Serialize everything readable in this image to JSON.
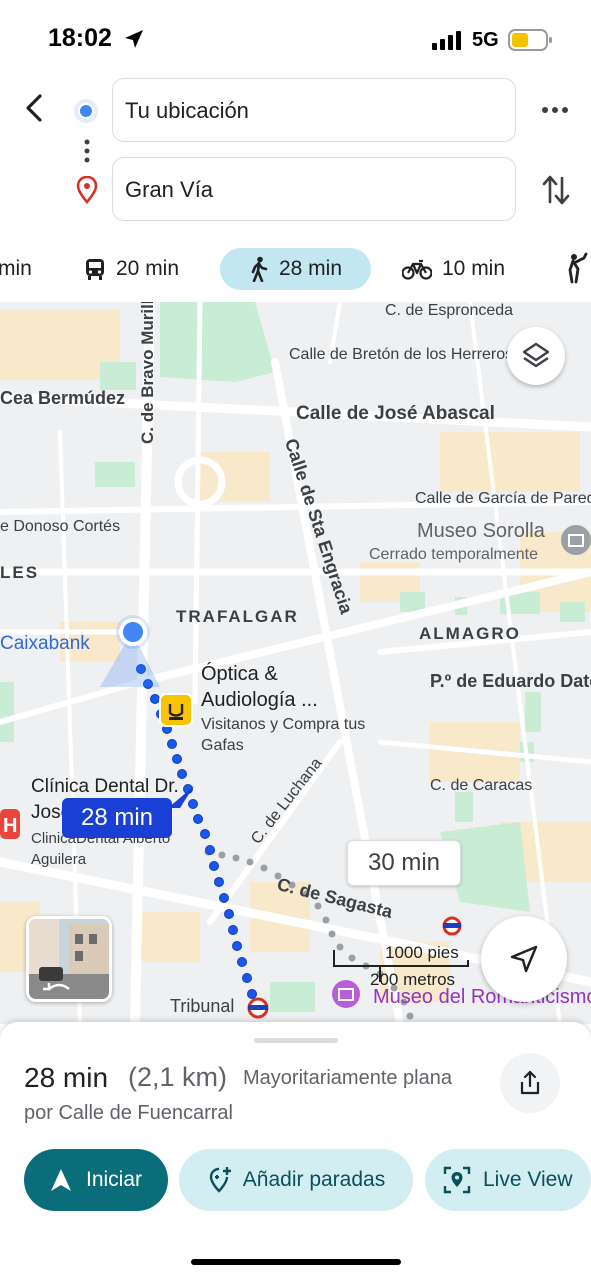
{
  "status_bar": {
    "time": "18:02",
    "network": "5G"
  },
  "directions": {
    "origin": "Tu ubicación",
    "destination": "Gran Vía"
  },
  "modes": {
    "drive": "min",
    "transit": "20 min",
    "walk": "28 min",
    "bike": "10 min"
  },
  "map": {
    "labels": {
      "esproncedo": "C. de Espronceda",
      "breton": "Calle de Bretón de los Herreros",
      "bravo_murillo": "C. de Bravo Murillo",
      "cea_bermudez": "Cea Bermúdez",
      "abascal": "Calle de José Abascal",
      "sta_engracia": "Calle de Sta Engracia",
      "garcia_paredes": "Calle de García de Paredes",
      "donoso_cortes": "e Donoso Cortés",
      "museo_sorolla": "Museo Sorolla",
      "cerrado": "Cerrado temporalmente",
      "les": "LES",
      "trafalgar": "TRAFALGAR",
      "almagro": "ALMAGRO",
      "caixabank": "Caixabank",
      "optica_1": "Óptica &",
      "optica_2": "Audiología ...",
      "optica_3": "Visitanos y Compra tus",
      "optica_4": "Gafas",
      "eduardo_dato": "P.º de Eduardo Dato",
      "clinica_1": "Clínica Dental Dr.",
      "clinica_2": "José...",
      "clinica_3": "ClinicaDental Alberto",
      "clinica_4": "Aguilera",
      "caracas": "C. de Caracas",
      "luchana": "C. de Luchana",
      "sagasta": "C. de Sagasta",
      "tribunal": "Tribunal",
      "museo_romanticismo": "Museo del Romanticismo",
      "scale_feet": "1000 pies",
      "scale_meters": "200 metros"
    },
    "route_badge": "28 min",
    "alt_badge": "30 min"
  },
  "sheet": {
    "duration": "28 min",
    "distance": "(2,1 km)",
    "terrain": "Mayoritariamente plana",
    "via": "por Calle de Fuencarral",
    "start_label": "Iniciar",
    "add_stops_label": "Añadir paradas",
    "live_view_label": "Live View"
  },
  "colors": {
    "accent_teal": "#0b6d7a",
    "selected_mode": "#c2e7f0",
    "route_blue": "#1a56f0",
    "location_blue": "#4285f4",
    "pill_bg": "#d3eef3"
  },
  "icons": [
    "location-arrow-icon",
    "signal-icon",
    "battery-icon",
    "back-arrow-icon",
    "origin-dot-icon",
    "destination-pin-icon",
    "more-icon",
    "swap-icon",
    "car-icon",
    "bus-icon",
    "walk-icon",
    "bike-icon",
    "ride-icon",
    "layers-icon",
    "navigate-icon",
    "share-icon",
    "start-arrow-icon",
    "add-stop-icon",
    "live-view-icon"
  ]
}
